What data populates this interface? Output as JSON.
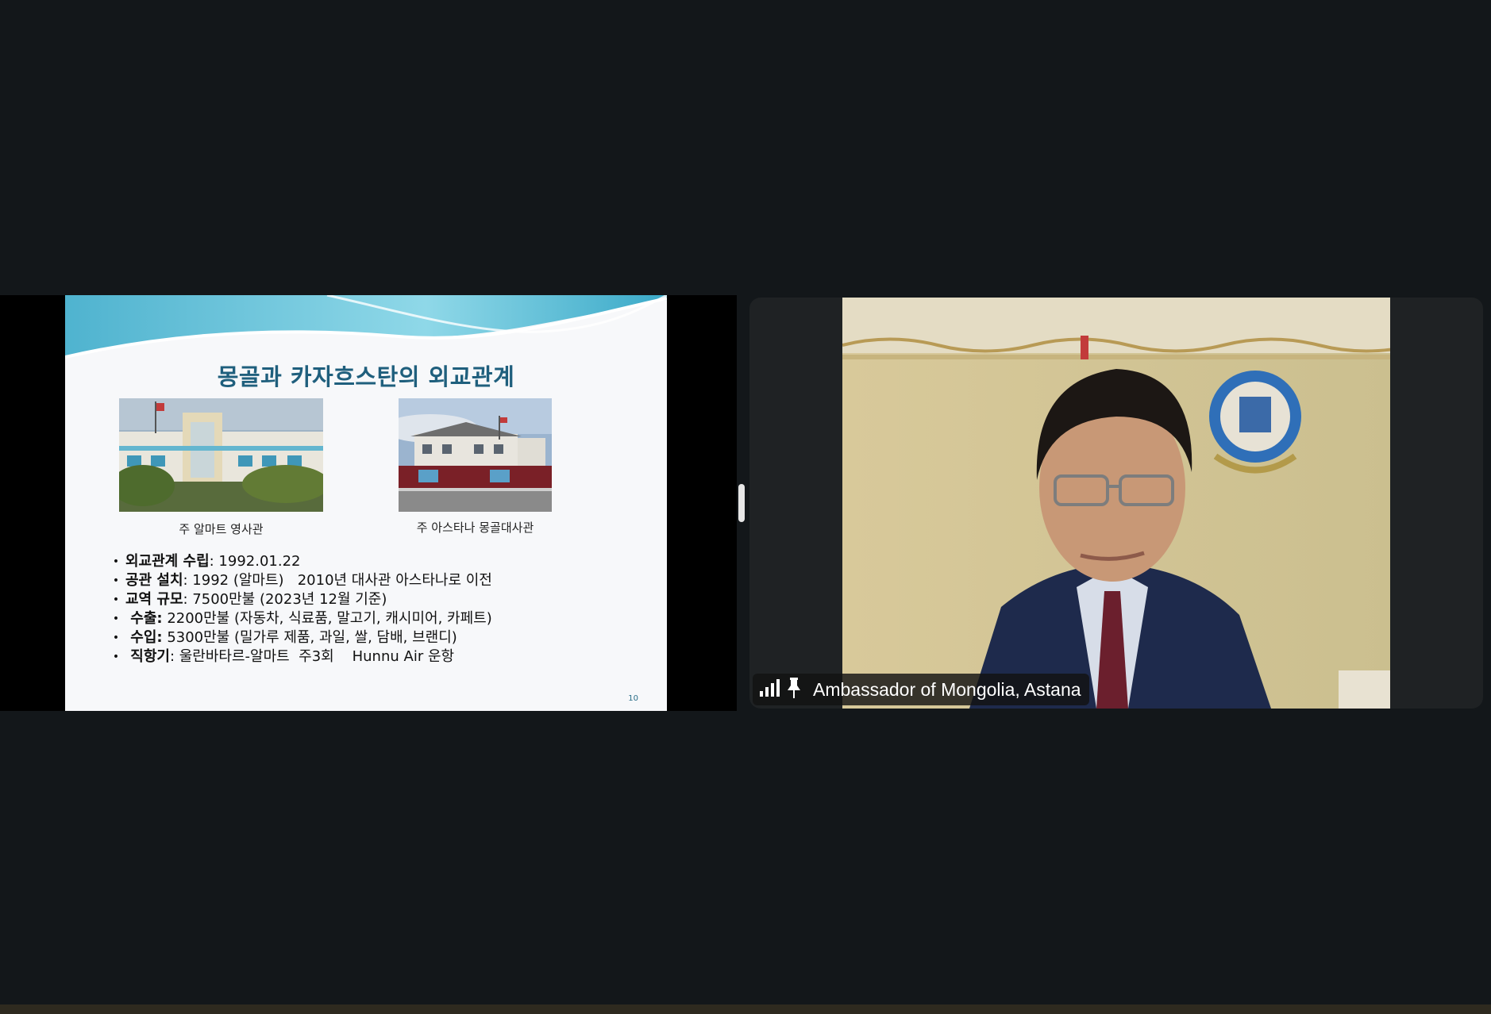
{
  "slide": {
    "title": "몽골과 카자흐스탄의 외교관계",
    "captions": [
      "주 알마트 영사관",
      "주 아스타나 몽골대사관"
    ],
    "bullets": [
      {
        "marker": "•",
        "bold": "외교관계 수립",
        "rest": ": 1992.01.22"
      },
      {
        "marker": "•",
        "bold": "공관 설치",
        "rest": ": 1992 (알마트)   2010년 대사관 아스타나로 이전"
      },
      {
        "marker": "•",
        "bold": "교역 규모",
        "rest": ": 7500만불 (2023년 12월 기준)"
      },
      {
        "marker": "•",
        "bold": " 수출:",
        "rest": " 2200만불 (자동차, 식료품, 말고기, 캐시미어, 카페트)"
      },
      {
        "marker": "•",
        "bold": " 수입:",
        "rest": " 5300만불 (밀가루 제품, 과일, 쌀, 담배, 브랜디)"
      },
      {
        "marker": "•",
        "bold": " 직항기",
        "rest": ": 울란바타르-알마트  주3회    Hunnu Air 운항"
      }
    ],
    "page_number": "10"
  },
  "participant": {
    "name": "Ambassador of Mongolia, Astana",
    "icons": [
      "signal-strength-icon",
      "pin-icon"
    ]
  },
  "colors": {
    "background": "#13171a",
    "slide_title": "#1f5f7d",
    "tile": "#1f2224"
  }
}
